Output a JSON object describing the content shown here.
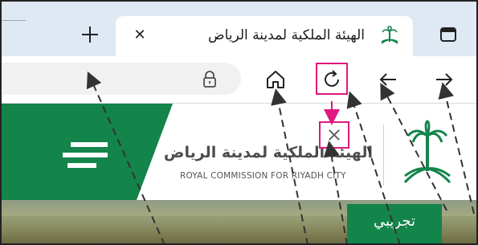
{
  "tab": {
    "title": "الهيئة الملكية لمدينة الرياض",
    "close_glyph": "✕",
    "favicon": "palm-swords-emblem"
  },
  "toolbar": {
    "icons": [
      "back-arrow-icon",
      "forward-arrow-icon",
      "reload-icon",
      "home-icon",
      "lock-icon",
      "new-tab-plus-icon",
      "sidebar-icon"
    ]
  },
  "site": {
    "brand_ar": "الهيئة الملكية لمدينة الرياض",
    "brand_en": "ROYAL COMMISSION FOR RIYADH CITY",
    "cta_label": "تجريبي",
    "colors": {
      "green": "#13844a",
      "highlight": "#e0197e"
    }
  }
}
